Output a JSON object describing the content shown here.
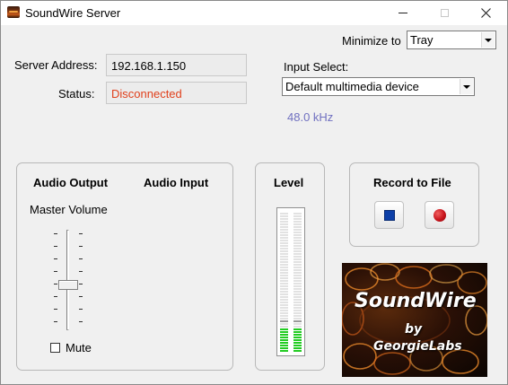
{
  "window": {
    "title": "SoundWire Server"
  },
  "options": {
    "minimize_label": "Minimize to",
    "minimize_value": "Tray"
  },
  "server": {
    "address_label": "Server Address:",
    "address_value": "192.168.1.150",
    "status_label": "Status:",
    "status_value": "Disconnected",
    "status_color": "#e0401c"
  },
  "input": {
    "label": "Input Select:",
    "device": "Default multimedia device",
    "sample_rate": "48.0 kHz",
    "sample_rate_color": "#7070c0"
  },
  "audio": {
    "output_label": "Audio Output",
    "input_label": "Audio Input",
    "master_volume_label": "Master Volume",
    "master_volume_level": 0.45,
    "mute_label": "Mute",
    "mute_checked": false
  },
  "level": {
    "label": "Level",
    "left_level": 0.18,
    "right_level": 0.18,
    "peak_color": "#22cc22"
  },
  "record": {
    "label": "Record to File",
    "stop_icon": "stop-icon",
    "record_icon": "record-icon"
  },
  "logo": {
    "title": "SoundWire",
    "by": "by",
    "company": "GeorgieLabs"
  }
}
